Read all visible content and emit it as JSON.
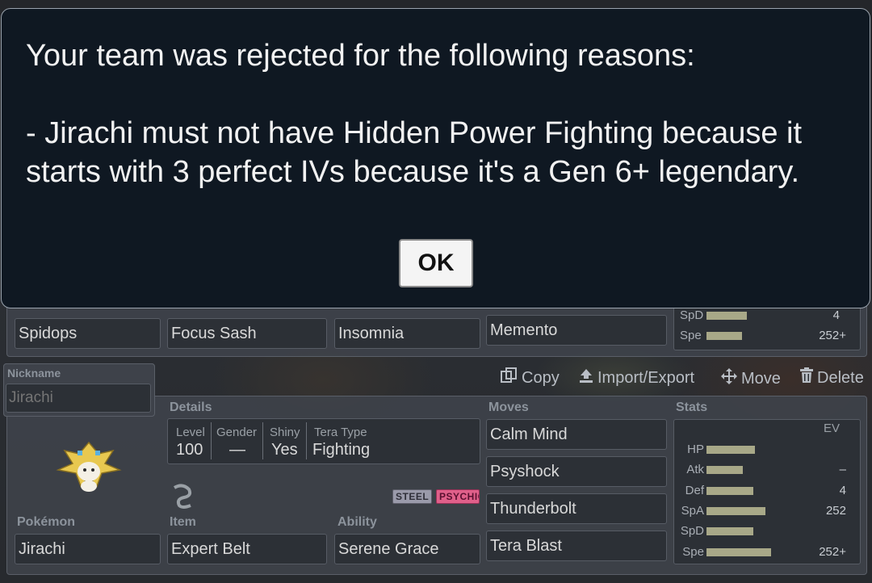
{
  "dialog": {
    "message": "Your team was rejected for the following reasons:\n\n- Jirachi must not have Hidden Power Fighting because it starts with 3 perfect IVs because it's a Gen 6+ legendary.",
    "ok_label": "OK"
  },
  "prev_set": {
    "pokemon": "Spidops",
    "item": "Focus Sash",
    "ability": "Insomnia",
    "move": "Memento",
    "stats": [
      {
        "label": "SpD",
        "ev": "4",
        "bar": 0.45
      },
      {
        "label": "Spe",
        "ev": "252+",
        "bar": 0.4
      }
    ]
  },
  "actions": {
    "copy": "Copy",
    "import_export": "Import/Export",
    "move": "Move",
    "delete": "Delete"
  },
  "set": {
    "nickname_label": "Nickname",
    "nickname_placeholder": "Jirachi",
    "details_label": "Details",
    "details": {
      "level_label": "Level",
      "level": "100",
      "gender_label": "Gender",
      "gender": "—",
      "shiny_label": "Shiny",
      "shiny": "Yes",
      "tera_label": "Tera Type",
      "tera": "Fighting"
    },
    "types": [
      "STEEL",
      "PSYCHIC"
    ],
    "pokemon_label": "Pokémon",
    "pokemon": "Jirachi",
    "item_label": "Item",
    "item": "Expert Belt",
    "ability_label": "Ability",
    "ability": "Serene Grace",
    "moves_label": "Moves",
    "moves": [
      "Calm Mind",
      "Psyshock",
      "Thunderbolt",
      "Tera Blast"
    ],
    "stats_label": "Stats",
    "ev_header": "EV",
    "stats": [
      {
        "label": "HP",
        "ev": "",
        "bar": 0.6
      },
      {
        "label": "Atk",
        "ev": "–",
        "bar": 0.45
      },
      {
        "label": "Def",
        "ev": "4",
        "bar": 0.58
      },
      {
        "label": "SpA",
        "ev": "252",
        "bar": 0.73
      },
      {
        "label": "SpD",
        "ev": "",
        "bar": 0.58
      },
      {
        "label": "Spe",
        "ev": "252+",
        "bar": 0.8
      }
    ]
  },
  "colors": {
    "steel": "#9a9aaa",
    "psychic": "#e0608a",
    "stat_bar": "#a8a888"
  }
}
